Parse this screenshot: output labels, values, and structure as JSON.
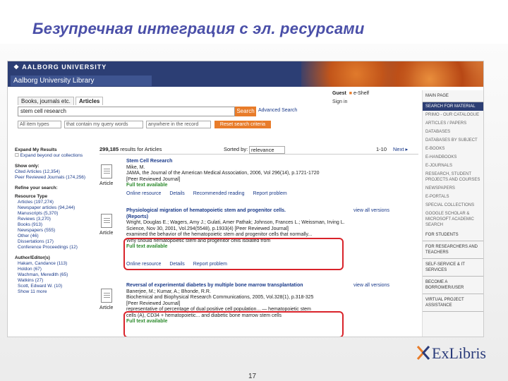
{
  "slide": {
    "title": "Безупречная интеграция с эл. ресурсами",
    "page_number": "17"
  },
  "banner": {
    "university": "AALBORG UNIVERSITY",
    "library": "Aalborg University Library"
  },
  "tabs": [
    "Books, journals etc.",
    "Articles"
  ],
  "search": {
    "value": "stem cell research",
    "button": "Search",
    "advanced": "Advanced Search",
    "filter1": "All item types",
    "filter2": "that contain my query words",
    "filter3": "anywhere in the record",
    "reset": "Reset search criteria"
  },
  "user": {
    "guest": "Guest",
    "eshelf": "e-Shelf",
    "signin": "Sign in"
  },
  "facets": {
    "expand_head": "Expand My Results",
    "expand_label": "Expand beyond our collections",
    "show_only": "Show only:",
    "show_only_items": [
      "Cited Articles (12,354)",
      "Peer Reviewed Journals (174,256)"
    ],
    "refine_head": "Refine your search:",
    "resource_type": "Resource Type",
    "resource_items": [
      "Articles (197,274)",
      "Newspaper articles (94,244)",
      "Manuscripts (5,370)",
      "Reviews (3,270)",
      "Books (913)",
      "Newspapers (555)",
      "Other (46)",
      "Dissertations (17)",
      "Conference Proceedings (12)"
    ],
    "author_head": "Author/Editor(s)",
    "author_items": [
      "Hakam, Candance (113)",
      "Holdon (67)",
      "Wachman, Meredith (65)",
      "Watkins (27)",
      "Scott, Edward W. (10)",
      "Show 11 more"
    ]
  },
  "results": {
    "count": "299,185",
    "for_text": "results for Articles",
    "sorted_by": "Sorted by:",
    "sort_value": "relevance",
    "range": "1-10",
    "next": "Next",
    "items": [
      {
        "type": "Article",
        "title": "Stem Cell Research",
        "lines": [
          "Mike, M.",
          "JAMA, the Journal of the American Medical Association, 2006, Vol 296(14), p.1721-1720",
          "[Peer Reviewed Journal]"
        ],
        "full": "Full text available",
        "links": [
          "Online resource",
          "Details",
          "Recommended reading",
          "Report problem"
        ],
        "versions": ""
      },
      {
        "type": "Article",
        "title": "Physiological migration of hematopoietic stem and progenitor cells.",
        "lines": [
          "(Reports)",
          "Wright, Douglas E.; Wagers, Amy J.; Gulati, Amer Pathak; Johnson, Frances L.; Weissman, Irving L.",
          "Science, Nov 30, 2001, Vol.294(5548), p.1933(4) [Peer Reviewed Journal]",
          "examined the behavior of the hematopoietic stem and progenitor cells that normally...",
          "Why should hematopoietic stem and progenitor cells isolated from"
        ],
        "full": "Full text available",
        "links": [
          "Online resource",
          "Details",
          "Report problem"
        ],
        "versions": "view all versions"
      },
      {
        "type": "Article",
        "title": "Reversal of experimental diabetes by multiple bone marrow transplantation",
        "lines": [
          "Banerjee, M.; Kumar, A.; Bhonde, R.R.",
          "Biochemical and Biophysical Research Communications, 2005, Vol.328(1), p.318-325",
          "[Peer Reviewed Journal]",
          "representative of percentage of dual positive cell population... — hematopoietic stem",
          "cells (A), CD34 + hematopoietic... and diabetic bone marrow stem cells"
        ],
        "full": "Full text available",
        "links": [],
        "versions": "view all versions"
      }
    ]
  },
  "rnav": [
    {
      "label": "MAIN PAGE",
      "kind": "main"
    },
    {
      "label": "SEARCH FOR MATERIAL",
      "kind": "active"
    },
    {
      "label": "PRIMO - OUR CATALOGUE",
      "kind": "sub"
    },
    {
      "label": "ARTICLES / PAPERS",
      "kind": "sub"
    },
    {
      "label": "DATABASES",
      "kind": "sub"
    },
    {
      "label": "DATABASES BY SUBJECT",
      "kind": "sub"
    },
    {
      "label": "E-BOOKS",
      "kind": "sub"
    },
    {
      "label": "E-HANDBOOKS",
      "kind": "sub"
    },
    {
      "label": "E-JOURNALS",
      "kind": "sub"
    },
    {
      "label": "RESEARCH, STUDENT PROJECTS AND COURSES",
      "kind": "sub"
    },
    {
      "label": "NEWSPAPERS",
      "kind": "sub"
    },
    {
      "label": "E-PORTALS",
      "kind": "sub"
    },
    {
      "label": "SPECIAL COLLECTIONS",
      "kind": "sub"
    },
    {
      "label": "GOOGLE SCHOLAR & MICROSOFT ACADEMIC SEARCH",
      "kind": "sub"
    },
    {
      "label": "FOR STUDENTS",
      "kind": "main"
    },
    {
      "label": "FOR RESEARCHERS AND TEACHERS",
      "kind": "main"
    },
    {
      "label": "SELF-SERVICE & IT SERVICES",
      "kind": "main"
    },
    {
      "label": "BECOME A BORROWER/USER",
      "kind": "main"
    },
    {
      "label": "VIRTUAL PROJECT ASSISTANCE",
      "kind": "main"
    }
  ],
  "logo": {
    "text": "ExLibris"
  }
}
